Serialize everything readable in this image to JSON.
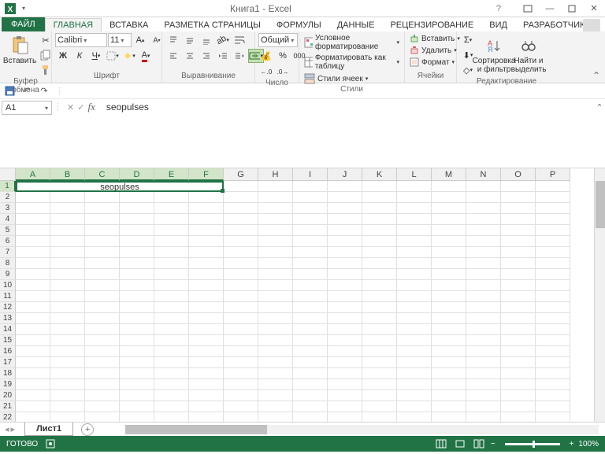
{
  "title": "Книга1 - Excel",
  "tabs": {
    "file": "ФАЙЛ",
    "items": [
      "ГЛАВНАЯ",
      "ВСТАВКА",
      "РАЗМЕТКА СТРАНИЦЫ",
      "ФОРМУЛЫ",
      "ДАННЫЕ",
      "РЕЦЕНЗИРОВАНИЕ",
      "ВИД",
      "РАЗРАБОТЧИК"
    ],
    "active": 0
  },
  "ribbon": {
    "clipboard": {
      "label": "Буфер обмена",
      "paste": "Вставить"
    },
    "font": {
      "label": "Шрифт",
      "name": "Calibri",
      "size": "11"
    },
    "alignment": {
      "label": "Выравнивание"
    },
    "number": {
      "label": "Число",
      "format": "Общий"
    },
    "styles": {
      "label": "Стили",
      "conditional": "Условное форматирование",
      "table": "Форматировать как таблицу",
      "cell": "Стили ячеек"
    },
    "cells": {
      "label": "Ячейки",
      "insert": "Вставить",
      "delete": "Удалить",
      "format": "Формат"
    },
    "editing": {
      "label": "Редактирование",
      "sort": "Сортировка и фильтр",
      "find": "Найти и выделить"
    }
  },
  "nameBox": "A1",
  "formula": "seopulses",
  "columns": [
    "A",
    "B",
    "C",
    "D",
    "E",
    "F",
    "G",
    "H",
    "I",
    "J",
    "K",
    "L",
    "M",
    "N",
    "O",
    "P"
  ],
  "rows": [
    "1",
    "2",
    "3",
    "4",
    "5",
    "6",
    "7",
    "8",
    "9",
    "10",
    "11",
    "12",
    "13",
    "14",
    "15",
    "16",
    "17",
    "18",
    "19",
    "20",
    "21",
    "22"
  ],
  "mergedCell": "seopulses",
  "sheet": "Лист1",
  "status": {
    "ready": "ГОТОВО",
    "zoom": "100%"
  }
}
